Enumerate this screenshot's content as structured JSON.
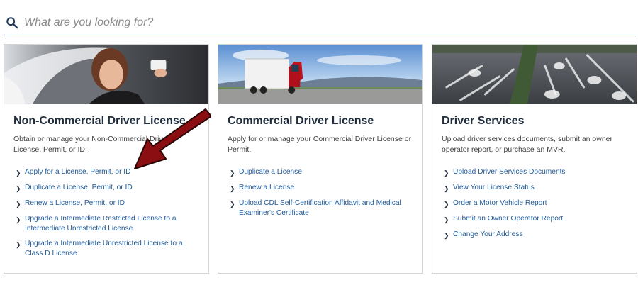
{
  "search": {
    "placeholder": "What are you looking for?"
  },
  "cards": [
    {
      "title": "Non-Commercial Driver License",
      "description": "Obtain or manage your Non-Commercial Driver License, Permit, or ID.",
      "links": [
        "Apply for a License, Permit, or ID",
        "Duplicate a License, Permit, or ID",
        "Renew a License, Permit, or ID",
        "Upgrade a Intermediate Restricted License to a Intermediate Unrestricted License",
        "Upgrade a Intermediate Unrestricted License to a Class D License"
      ]
    },
    {
      "title": "Commercial Driver License",
      "description": "Apply for or manage your Commercial Driver License or Permit.",
      "links": [
        "Duplicate a License",
        "Renew a License",
        "Upload CDL Self-Certification Affidavit and Medical Examiner's Certificate"
      ]
    },
    {
      "title": "Driver Services",
      "description": "Upload driver services documents, submit an owner operator report, or purchase an MVR.",
      "links": [
        "Upload Driver Services Documents",
        "View Your License Status",
        "Order a Motor Vehicle Report",
        "Submit an Owner Operator Report",
        "Change Your Address"
      ]
    }
  ],
  "colors": {
    "link": "#1f5a99",
    "title": "#1f2d3d",
    "arrow": "#8b0f12",
    "search_underline": "#1f3a5f"
  }
}
